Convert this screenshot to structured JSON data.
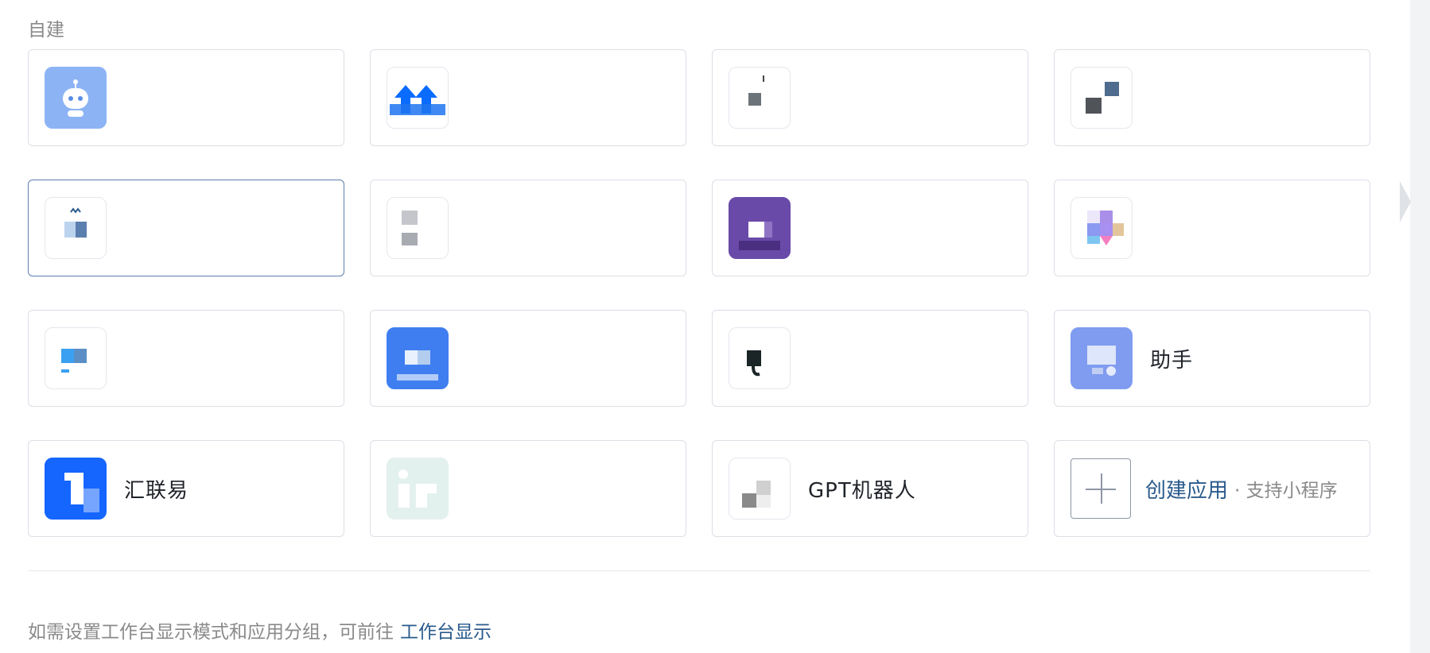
{
  "section": {
    "title": "自建"
  },
  "apps": [
    {
      "name": "",
      "icon": "robot-icon",
      "icon_bg": "#8cb4f5"
    },
    {
      "name": "",
      "icon": "arrows-up-icon",
      "icon_bg": "#0a6cff"
    },
    {
      "name": "",
      "icon": "app-icon",
      "icon_bg": "#ffffff"
    },
    {
      "name": "",
      "icon": "app-icon",
      "icon_bg": "#ffffff"
    },
    {
      "name": "",
      "icon": "mountain-icon",
      "icon_bg": "#ffffff"
    },
    {
      "name": "",
      "icon": "app-icon",
      "icon_bg": "#ffffff"
    },
    {
      "name": "",
      "icon": "app-icon",
      "icon_bg": "#6a4aa8"
    },
    {
      "name": "",
      "icon": "puzzle-icon",
      "icon_bg": "#c9b8f0"
    },
    {
      "name": "",
      "icon": "chat-icon",
      "icon_bg": "#ffffff"
    },
    {
      "name": "",
      "icon": "chat-icon",
      "icon_bg": "#3f7ef0"
    },
    {
      "name": "",
      "icon": "app-icon",
      "icon_bg": "#ffffff"
    },
    {
      "name": "助手",
      "icon": "assistant-icon",
      "icon_bg": "#7f9cf0"
    },
    {
      "name": "汇联易",
      "icon": "logo-icon",
      "icon_bg": "#1565ff"
    },
    {
      "name": "",
      "icon": "app-icon",
      "icon_bg": "#e3f1ee"
    },
    {
      "name": "GPT机器人",
      "icon": "app-icon",
      "icon_bg": "#ffffff"
    }
  ],
  "create": {
    "label": "创建应用",
    "sub": "· 支持小程序"
  },
  "footer": {
    "text": "如需设置工作台显示模式和应用分组，可前往",
    "link": "工作台显示"
  }
}
